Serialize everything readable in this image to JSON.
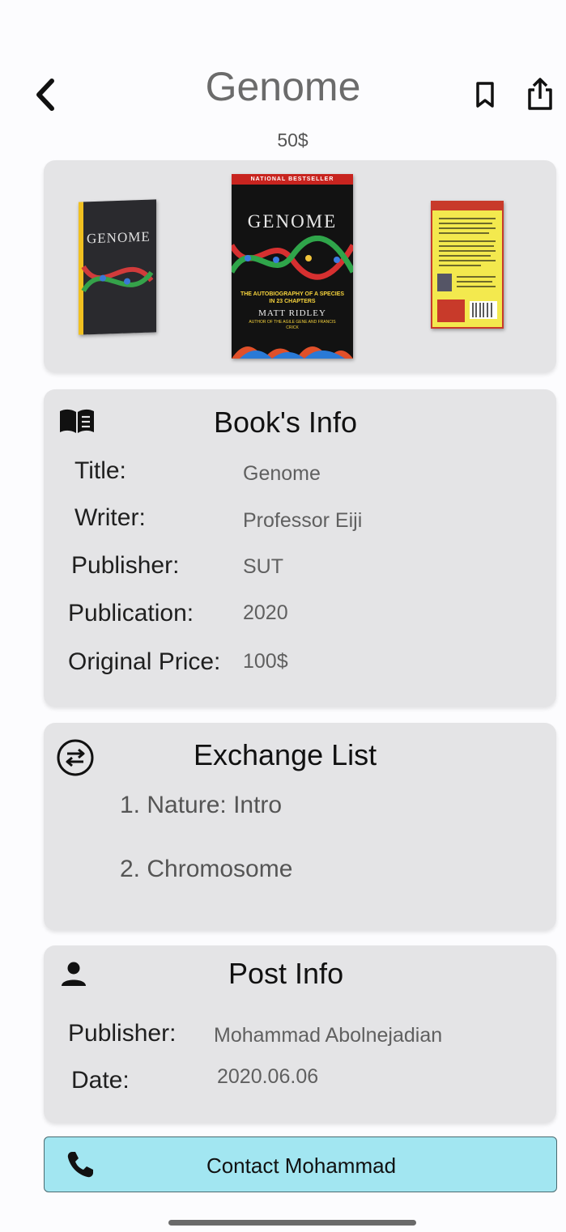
{
  "header": {
    "title": "Genome",
    "price": "50$",
    "back_icon": "chevron-left-icon",
    "bookmark_icon": "bookmark-icon",
    "share_icon": "share-icon"
  },
  "gallery": {
    "images": [
      {
        "name": "book-side-image",
        "cover_text": "GENOME"
      },
      {
        "name": "book-front-image",
        "banner": "NATIONAL BESTSELLER",
        "cover_text": "GENOME",
        "subtitle": "THE AUTOBIOGRAPHY OF A SPECIES IN 23 CHAPTERS",
        "author": "MATT RIDLEY",
        "tagline": "AUTHOR OF THE AGILE GENE AND FRANCIS CRICK"
      },
      {
        "name": "book-back-image"
      }
    ]
  },
  "book_info": {
    "icon": "open-book-icon",
    "title": "Book's Info",
    "rows": [
      {
        "label": "Title:",
        "value": "Genome"
      },
      {
        "label": "Writer:",
        "value": "Professor Eiji"
      },
      {
        "label": "Publisher:",
        "value": "SUT"
      },
      {
        "label": "Publication:",
        "value": "2020"
      },
      {
        "label": "Original Price:",
        "value": "100$"
      }
    ]
  },
  "exchange_list": {
    "icon": "exchange-icon",
    "title": "Exchange List",
    "items": [
      "1.  Nature: Intro",
      "2.  Chromosome"
    ]
  },
  "post_info": {
    "icon": "person-icon",
    "title": "Post Info",
    "rows": [
      {
        "label": "Publisher:",
        "value": "Mohammad Abolnejadian"
      },
      {
        "label": "Date:",
        "value": "2020.06.06"
      }
    ]
  },
  "contact": {
    "icon": "phone-icon",
    "label": "Contact Mohammad"
  },
  "colors": {
    "background": "#fcfcfe",
    "card": "#e4e4e6",
    "contact_button": "#a2e6f1"
  }
}
